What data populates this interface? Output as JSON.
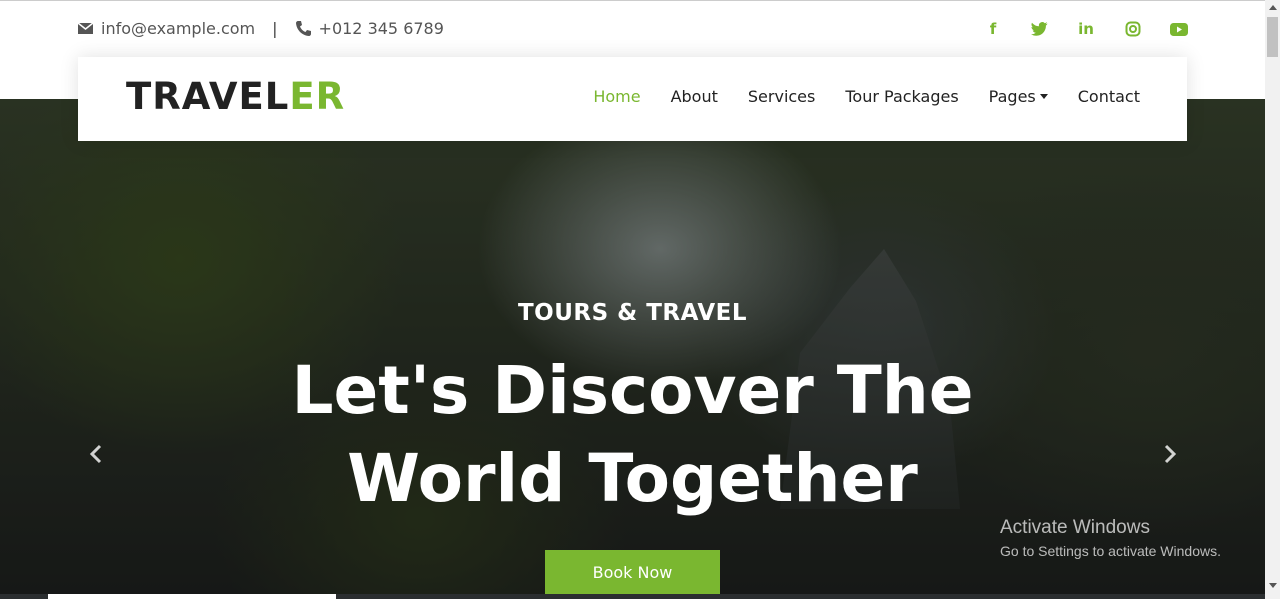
{
  "topbar": {
    "email": "info@example.com",
    "separator": "|",
    "phone": "+012 345 6789",
    "socials": [
      {
        "icon": "facebook-icon",
        "glyph": "f"
      },
      {
        "icon": "twitter-icon",
        "glyph": "t"
      },
      {
        "icon": "linkedin-icon",
        "glyph": "in"
      },
      {
        "icon": "instagram-icon",
        "glyph": "◎"
      },
      {
        "icon": "youtube-icon",
        "glyph": "▶"
      }
    ]
  },
  "brand": {
    "logo_main": "TRAVEL",
    "logo_accent": "ER",
    "accent_color": "#7ab730"
  },
  "nav": {
    "items": [
      "Home",
      "About",
      "Services",
      "Tour Packages",
      "Pages",
      "Contact"
    ],
    "active": "Home"
  },
  "hero": {
    "subtitle": "TOURS & TRAVEL",
    "title_line1": "Let's Discover The",
    "title_line2": "World Together",
    "cta": "Book Now"
  },
  "os_watermark": {
    "line1": "Activate Windows",
    "line2": "Go to Settings to activate Windows."
  }
}
